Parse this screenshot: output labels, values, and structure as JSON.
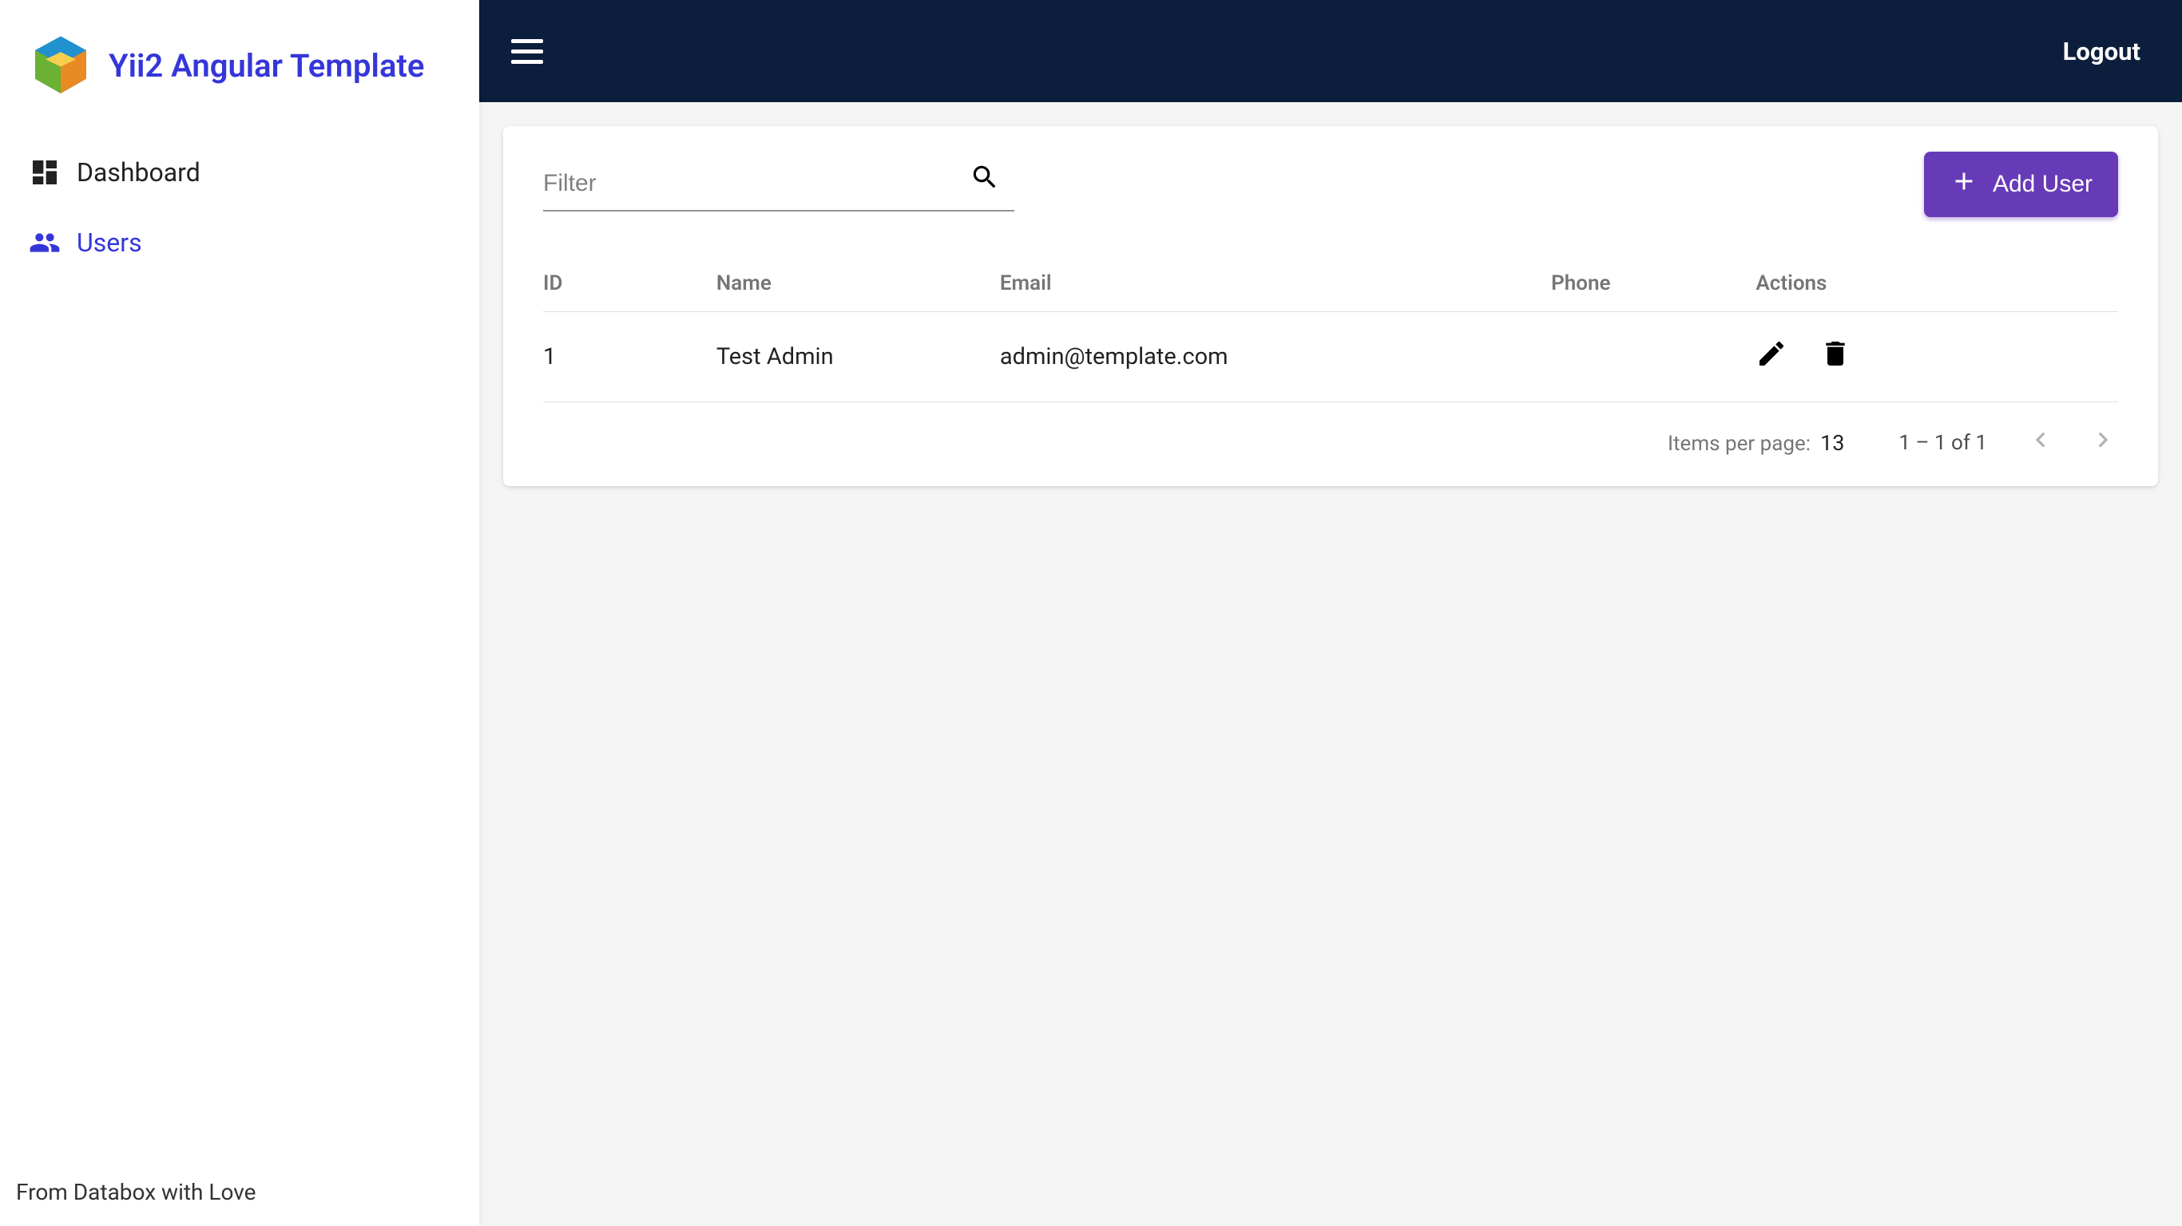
{
  "brand": {
    "title": "Yii2 Angular Template"
  },
  "sidebar": {
    "items": [
      {
        "label": "Dashboard"
      },
      {
        "label": "Users"
      }
    ],
    "footer": "From Databox with Love"
  },
  "topbar": {
    "logout": "Logout"
  },
  "filter": {
    "placeholder": "Filter"
  },
  "add_user_button": "Add User",
  "columns": {
    "id": "ID",
    "name": "Name",
    "email": "Email",
    "phone": "Phone",
    "actions": "Actions"
  },
  "rows": [
    {
      "id": "1",
      "name": "Test Admin",
      "email": "admin@template.com",
      "phone": ""
    }
  ],
  "paginator": {
    "items_per_page_label": "Items per page:",
    "items_per_page_value": "13",
    "range": "1 – 1 of 1"
  }
}
